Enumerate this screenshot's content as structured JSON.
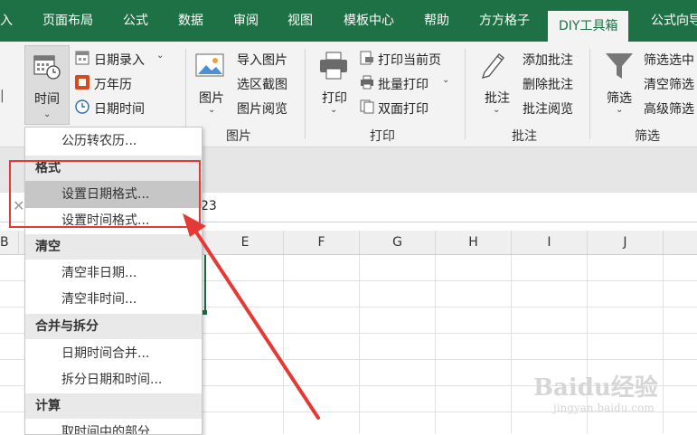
{
  "tabs": [
    "入",
    "页面布局",
    "公式",
    "数据",
    "审阅",
    "视图",
    "模板中心",
    "帮助",
    "方方格子",
    "DIY工具箱",
    "公式向导"
  ],
  "active_tab": "DIY工具箱",
  "ribbon": {
    "time_button": "时间",
    "date_group": {
      "date_entry": "日期录入",
      "calendar": "万年历",
      "datetime": "日期时间"
    },
    "image_button": "图片",
    "image_group": {
      "import": "导入图片",
      "region": "选区截图",
      "view": "图片阅览"
    },
    "image_group_label": "图片",
    "print_button": "打印",
    "print_group": {
      "current": "打印当前页",
      "batch": "批量打印",
      "duplex": "双面打印"
    },
    "print_group_label": "打印",
    "annotate_button": "批注",
    "annotate_group": {
      "add": "添加批注",
      "delete": "删除批注",
      "view": "批注阅览"
    },
    "annotate_group_label": "批注",
    "filter_button": "筛选",
    "filter_group": {
      "filter_select": "筛选选中",
      "clear_filter": "清空筛选",
      "advanced": "高级筛选"
    },
    "filter_group_label": "筛选"
  },
  "formula_value": "23",
  "columns": [
    "B",
    "E",
    "F",
    "G",
    "H",
    "I",
    "J"
  ],
  "menu": {
    "item_lunar": "公历转农历...",
    "header_format": "格式",
    "item_set_date": "设置日期格式...",
    "item_set_time": "设置时间格式...",
    "header_clear": "清空",
    "item_clear_date": "清空非日期...",
    "item_clear_time": "清空非时间...",
    "header_merge": "合并与拆分",
    "item_merge": "日期时间合并...",
    "item_split": "拆分日期和时间...",
    "header_calc": "计算",
    "item_part": "取时间中的部分..."
  },
  "watermark": {
    "brand": "Baidu经验",
    "url": "jingyan.baidu.com"
  },
  "colors": {
    "tab_green": "#1e7145",
    "highlight_red": "#e53935"
  }
}
